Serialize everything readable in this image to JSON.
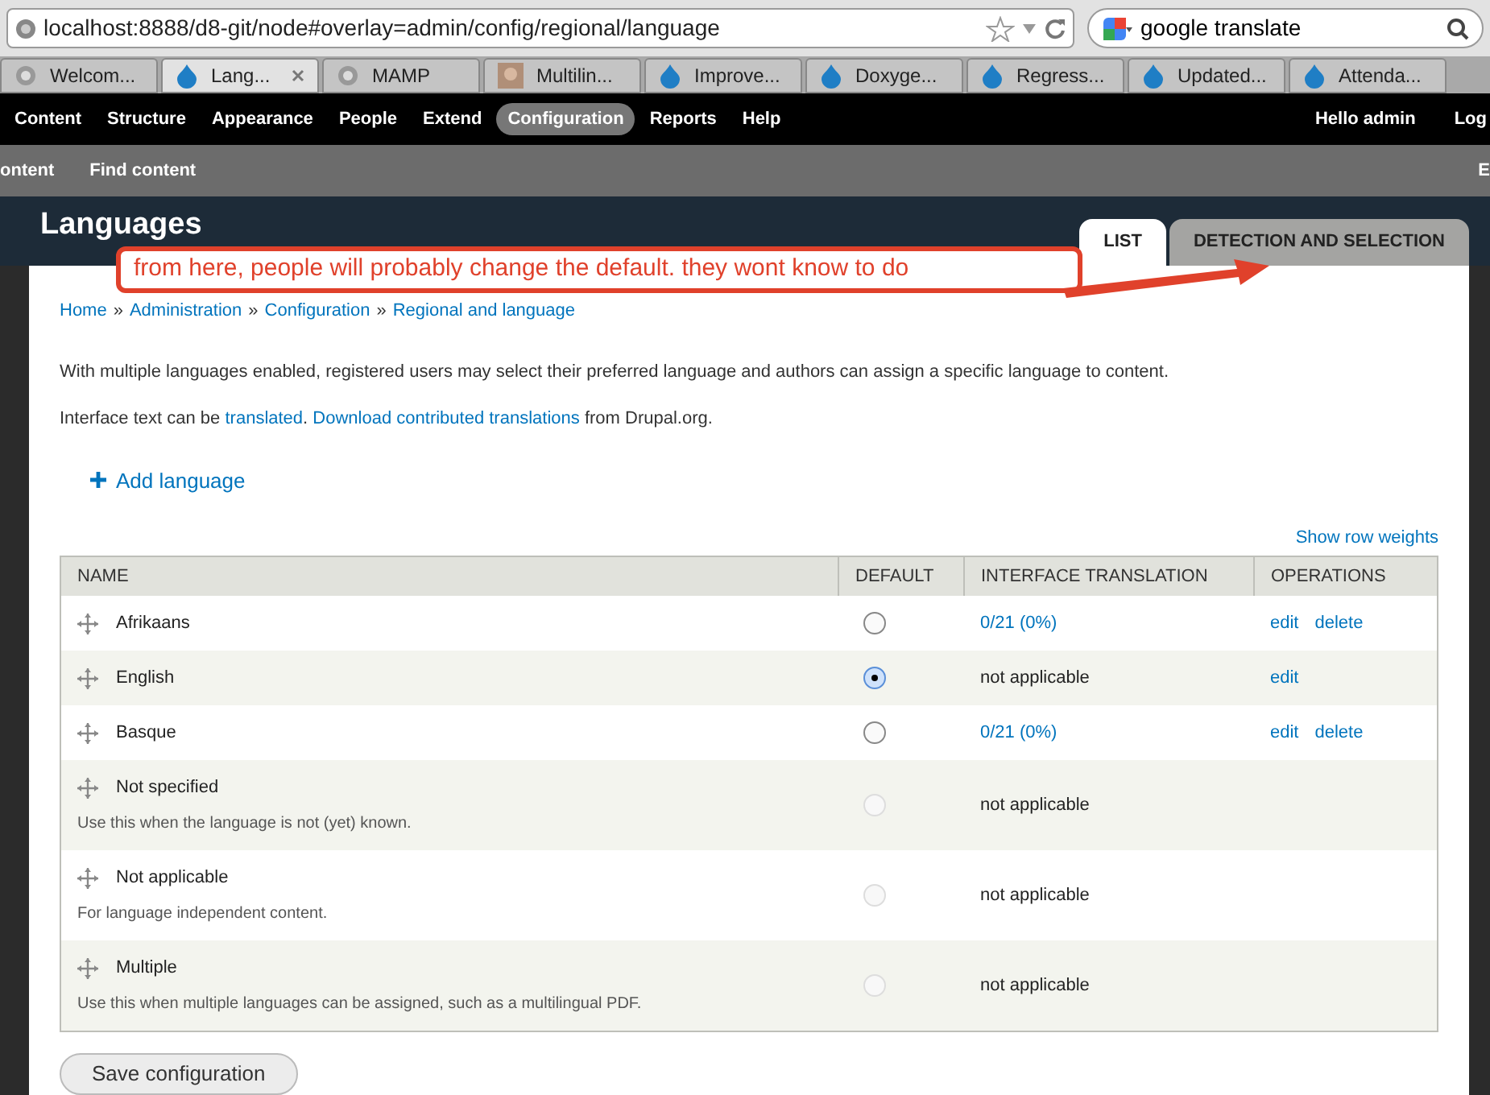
{
  "browser": {
    "address": "localhost:8888/d8-git/node#overlay=admin/config/regional/language",
    "search": "google translate",
    "tabs": [
      {
        "label": "Welcom...",
        "selected": false,
        "kind": "page"
      },
      {
        "label": "Lang...",
        "selected": true,
        "kind": "drupal"
      },
      {
        "label": "MAMP",
        "selected": false,
        "kind": "page"
      },
      {
        "label": "Multilin...",
        "selected": false,
        "kind": "photo"
      },
      {
        "label": "Improve...",
        "selected": false,
        "kind": "drupal"
      },
      {
        "label": "Doxyge...",
        "selected": false,
        "kind": "drupal"
      },
      {
        "label": "Regress...",
        "selected": false,
        "kind": "drupal"
      },
      {
        "label": "Updated...",
        "selected": false,
        "kind": "drupal"
      },
      {
        "label": "Attenda...",
        "selected": false,
        "kind": "drupal"
      }
    ]
  },
  "toolbar": {
    "items": [
      {
        "label": "Content",
        "selected": false
      },
      {
        "label": "Structure",
        "selected": false
      },
      {
        "label": "Appearance",
        "selected": false
      },
      {
        "label": "People",
        "selected": false
      },
      {
        "label": "Extend",
        "selected": false
      },
      {
        "label": "Configuration",
        "selected": true
      },
      {
        "label": "Reports",
        "selected": false
      },
      {
        "label": "Help",
        "selected": false
      }
    ],
    "user": "Hello admin",
    "logout": "Log"
  },
  "shortcuts": {
    "items": [
      "ontent",
      "Find content"
    ],
    "edit": "E"
  },
  "page": {
    "title": "Languages",
    "tabs": [
      {
        "label": "LIST",
        "selected": true
      },
      {
        "label": "DETECTION AND SELECTION",
        "selected": false
      }
    ],
    "annotation": "from here, people will probably change the default. they wont know to do",
    "breadcrumb": [
      "Home",
      "Administration",
      "Configuration",
      "Regional and language"
    ],
    "breadcrumb_separator": "»",
    "intro": "With multiple languages enabled, registered users may select their preferred language and authors can assign a specific language to content.",
    "interface_text": [
      {
        "kind": "text",
        "text": "Interface text can be "
      },
      {
        "kind": "link",
        "text": "translated"
      },
      {
        "kind": "text",
        "text": ". "
      },
      {
        "kind": "link",
        "text": "Download contributed translations"
      },
      {
        "kind": "text",
        "text": " from Drupal.org."
      }
    ],
    "add_language": "Add language",
    "row_weights": "Show row weights",
    "table": {
      "columns": [
        "NAME",
        "DEFAULT",
        "INTERFACE TRANSLATION",
        "OPERATIONS"
      ],
      "rows": [
        {
          "name": "Afrikaans",
          "default": {
            "selected": false,
            "disabled": false
          },
          "translation": {
            "kind": "link",
            "text": "0/21 (0%)"
          },
          "operations": [
            "edit",
            "delete"
          ]
        },
        {
          "name": "English",
          "default": {
            "selected": true,
            "disabled": false
          },
          "translation": {
            "kind": "text",
            "text": "not applicable"
          },
          "operations": [
            "edit"
          ]
        },
        {
          "name": "Basque",
          "default": {
            "selected": false,
            "disabled": false
          },
          "translation": {
            "kind": "link",
            "text": "0/21 (0%)"
          },
          "operations": [
            "edit",
            "delete"
          ]
        },
        {
          "name": "Not specified",
          "description": "Use this when the language is not (yet) known.",
          "default": {
            "selected": false,
            "disabled": true
          },
          "translation": {
            "kind": "text",
            "text": "not applicable"
          }
        },
        {
          "name": "Not applicable",
          "description": "For language independent content.",
          "default": {
            "selected": false,
            "disabled": true
          },
          "translation": {
            "kind": "text",
            "text": "not applicable"
          }
        },
        {
          "name": "Multiple",
          "description": "Use this when multiple languages can be assigned, such as a multilingual PDF.",
          "default": {
            "selected": false,
            "disabled": true
          },
          "translation": {
            "kind": "text",
            "text": "not applicable"
          }
        }
      ]
    },
    "save": "Save configuration"
  }
}
